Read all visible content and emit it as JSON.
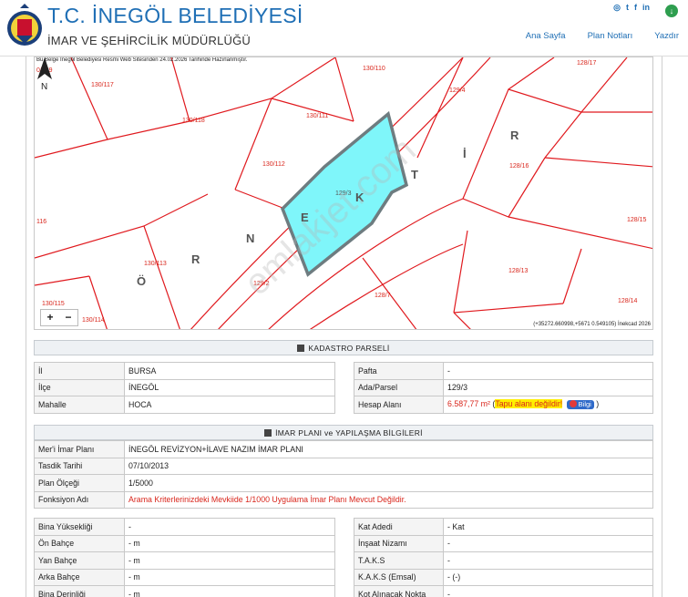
{
  "header": {
    "title": "T.C. İNEGÖL BELEDİYESİ",
    "subtitle": "İMAR VE ŞEHİRCİLİK MÜDÜRLÜĞÜ",
    "nav": [
      "Ana Sayfa",
      "Plan Notları",
      "Yazdır"
    ],
    "social_icons": [
      "web-icon",
      "twitter-icon",
      "facebook-icon",
      "linkedin-icon"
    ],
    "download_icon": "download-icon"
  },
  "map": {
    "note": "Bu Belge İnegöl Belediyesi Resmi Web Sitesinden 24.02.2026 Tarihinde Hazırlanmıştır.",
    "coords": "(+35272.660998,+5671 0.549105) İnekcad 2026",
    "zoom_in": "+",
    "zoom_out": "−",
    "north_label": "N",
    "watermark": "emlakjet.com",
    "parcel_labels": [
      "0/129",
      "130/117",
      "130/110",
      "128/17",
      "129/4",
      "130/118",
      "130/111",
      "130/112",
      "128/16",
      "129/3",
      "128/15",
      "116",
      "130/113",
      "128/13",
      "129/2",
      "128/7",
      "130/115",
      "130/114",
      "128/14"
    ],
    "street_letters": [
      "R",
      "İ",
      "T",
      "K",
      "E",
      "N",
      "R",
      "Ö"
    ],
    "colors": {
      "parcel_fill": "#7ff6fa",
      "parcel_border": "#6e7c80",
      "lines": "#e0191e",
      "labels": "#d9261c"
    }
  },
  "kadastro": {
    "heading": "KADASTRO PARSELİ",
    "left": [
      {
        "label": "İl",
        "value": "BURSA"
      },
      {
        "label": "İlçe",
        "value": "İNEGÖL"
      },
      {
        "label": "Mahalle",
        "value": "HOCA"
      }
    ],
    "right": [
      {
        "label": "Pafta",
        "value": "-"
      },
      {
        "label": "Ada/Parsel",
        "value": "129/3"
      }
    ],
    "hesap": {
      "label": "Hesap Alanı",
      "value": "6.587,77 m²",
      "open": "(",
      "warning": "Tapu alanı değildir!",
      "bilgi": "Bilgi",
      "close": ")"
    }
  },
  "imar": {
    "heading": "İMAR PLANI ve YAPILAŞMA BİLGİLERİ",
    "rows": [
      {
        "label": "Mer'i İmar Planı",
        "value": "İNEGÖL REVİZYON+İLAVE NAZIM İMAR PLANI"
      },
      {
        "label": "Tasdik Tarihi",
        "value": "07/10/2013"
      },
      {
        "label": "Plan Ölçeği",
        "value": "1/5000"
      }
    ],
    "fonksiyon": {
      "label": "Fonksiyon Adı",
      "value": "Arama Kriterlerinizdeki Mevkiide 1/1000 Uygulama İmar Planı Mevcut Değildir."
    }
  },
  "yapilasma": {
    "left": [
      {
        "label": "Bina Yüksekliği",
        "value": "-"
      },
      {
        "label": "Ön Bahçe",
        "value": "- m"
      },
      {
        "label": "Yan Bahçe",
        "value": "- m"
      },
      {
        "label": "Arka Bahçe",
        "value": "- m"
      },
      {
        "label": "Bina Derinliği",
        "value": "- m"
      }
    ],
    "right": [
      {
        "label": "Kat Adedi",
        "value": "- Kat"
      },
      {
        "label": "İnşaat Nizamı",
        "value": "-"
      },
      {
        "label": "T.A.K.S",
        "value": "-"
      },
      {
        "label": "K.A.K.S (Emsal)",
        "value": "- (-)"
      },
      {
        "label": "Kot Alınacak Nokta",
        "value": "-"
      }
    ]
  }
}
